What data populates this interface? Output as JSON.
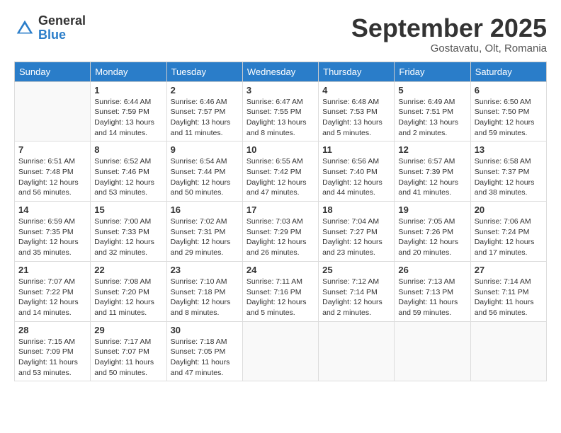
{
  "header": {
    "logo_general": "General",
    "logo_blue": "Blue",
    "month_title": "September 2025",
    "subtitle": "Gostavatu, Olt, Romania"
  },
  "days_of_week": [
    "Sunday",
    "Monday",
    "Tuesday",
    "Wednesday",
    "Thursday",
    "Friday",
    "Saturday"
  ],
  "weeks": [
    [
      {
        "day": "",
        "info": ""
      },
      {
        "day": "1",
        "info": "Sunrise: 6:44 AM\nSunset: 7:59 PM\nDaylight: 13 hours\nand 14 minutes."
      },
      {
        "day": "2",
        "info": "Sunrise: 6:46 AM\nSunset: 7:57 PM\nDaylight: 13 hours\nand 11 minutes."
      },
      {
        "day": "3",
        "info": "Sunrise: 6:47 AM\nSunset: 7:55 PM\nDaylight: 13 hours\nand 8 minutes."
      },
      {
        "day": "4",
        "info": "Sunrise: 6:48 AM\nSunset: 7:53 PM\nDaylight: 13 hours\nand 5 minutes."
      },
      {
        "day": "5",
        "info": "Sunrise: 6:49 AM\nSunset: 7:51 PM\nDaylight: 13 hours\nand 2 minutes."
      },
      {
        "day": "6",
        "info": "Sunrise: 6:50 AM\nSunset: 7:50 PM\nDaylight: 12 hours\nand 59 minutes."
      }
    ],
    [
      {
        "day": "7",
        "info": "Sunrise: 6:51 AM\nSunset: 7:48 PM\nDaylight: 12 hours\nand 56 minutes."
      },
      {
        "day": "8",
        "info": "Sunrise: 6:52 AM\nSunset: 7:46 PM\nDaylight: 12 hours\nand 53 minutes."
      },
      {
        "day": "9",
        "info": "Sunrise: 6:54 AM\nSunset: 7:44 PM\nDaylight: 12 hours\nand 50 minutes."
      },
      {
        "day": "10",
        "info": "Sunrise: 6:55 AM\nSunset: 7:42 PM\nDaylight: 12 hours\nand 47 minutes."
      },
      {
        "day": "11",
        "info": "Sunrise: 6:56 AM\nSunset: 7:40 PM\nDaylight: 12 hours\nand 44 minutes."
      },
      {
        "day": "12",
        "info": "Sunrise: 6:57 AM\nSunset: 7:39 PM\nDaylight: 12 hours\nand 41 minutes."
      },
      {
        "day": "13",
        "info": "Sunrise: 6:58 AM\nSunset: 7:37 PM\nDaylight: 12 hours\nand 38 minutes."
      }
    ],
    [
      {
        "day": "14",
        "info": "Sunrise: 6:59 AM\nSunset: 7:35 PM\nDaylight: 12 hours\nand 35 minutes."
      },
      {
        "day": "15",
        "info": "Sunrise: 7:00 AM\nSunset: 7:33 PM\nDaylight: 12 hours\nand 32 minutes."
      },
      {
        "day": "16",
        "info": "Sunrise: 7:02 AM\nSunset: 7:31 PM\nDaylight: 12 hours\nand 29 minutes."
      },
      {
        "day": "17",
        "info": "Sunrise: 7:03 AM\nSunset: 7:29 PM\nDaylight: 12 hours\nand 26 minutes."
      },
      {
        "day": "18",
        "info": "Sunrise: 7:04 AM\nSunset: 7:27 PM\nDaylight: 12 hours\nand 23 minutes."
      },
      {
        "day": "19",
        "info": "Sunrise: 7:05 AM\nSunset: 7:26 PM\nDaylight: 12 hours\nand 20 minutes."
      },
      {
        "day": "20",
        "info": "Sunrise: 7:06 AM\nSunset: 7:24 PM\nDaylight: 12 hours\nand 17 minutes."
      }
    ],
    [
      {
        "day": "21",
        "info": "Sunrise: 7:07 AM\nSunset: 7:22 PM\nDaylight: 12 hours\nand 14 minutes."
      },
      {
        "day": "22",
        "info": "Sunrise: 7:08 AM\nSunset: 7:20 PM\nDaylight: 12 hours\nand 11 minutes."
      },
      {
        "day": "23",
        "info": "Sunrise: 7:10 AM\nSunset: 7:18 PM\nDaylight: 12 hours\nand 8 minutes."
      },
      {
        "day": "24",
        "info": "Sunrise: 7:11 AM\nSunset: 7:16 PM\nDaylight: 12 hours\nand 5 minutes."
      },
      {
        "day": "25",
        "info": "Sunrise: 7:12 AM\nSunset: 7:14 PM\nDaylight: 12 hours\nand 2 minutes."
      },
      {
        "day": "26",
        "info": "Sunrise: 7:13 AM\nSunset: 7:13 PM\nDaylight: 11 hours\nand 59 minutes."
      },
      {
        "day": "27",
        "info": "Sunrise: 7:14 AM\nSunset: 7:11 PM\nDaylight: 11 hours\nand 56 minutes."
      }
    ],
    [
      {
        "day": "28",
        "info": "Sunrise: 7:15 AM\nSunset: 7:09 PM\nDaylight: 11 hours\nand 53 minutes."
      },
      {
        "day": "29",
        "info": "Sunrise: 7:17 AM\nSunset: 7:07 PM\nDaylight: 11 hours\nand 50 minutes."
      },
      {
        "day": "30",
        "info": "Sunrise: 7:18 AM\nSunset: 7:05 PM\nDaylight: 11 hours\nand 47 minutes."
      },
      {
        "day": "",
        "info": ""
      },
      {
        "day": "",
        "info": ""
      },
      {
        "day": "",
        "info": ""
      },
      {
        "day": "",
        "info": ""
      }
    ]
  ]
}
